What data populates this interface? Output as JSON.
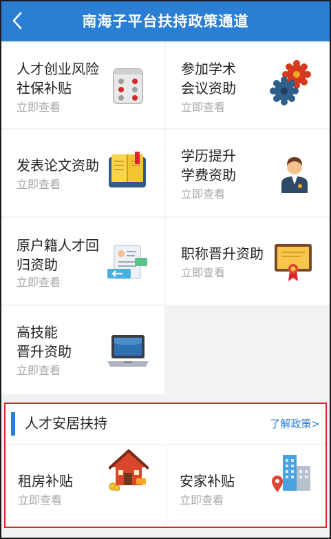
{
  "header": {
    "title": "南海子平台扶持政策通道"
  },
  "cards": [
    {
      "label": "人才创业风险\n社保补贴",
      "sub": "立即查看",
      "icon": "dice-icon"
    },
    {
      "label": "参加学术\n会议资助",
      "sub": "立即查看",
      "icon": "gears-icon"
    },
    {
      "label": "发表论文资助",
      "sub": "立即查看",
      "icon": "book-icon"
    },
    {
      "label": "学历提升\n学费资助",
      "sub": "立即查看",
      "icon": "graduate-icon"
    },
    {
      "label": "原户籍人才回\n归资助",
      "sub": "立即查看",
      "icon": "resume-icon"
    },
    {
      "label": "职称晋升资助",
      "sub": "立即查看",
      "icon": "certificate-icon"
    },
    {
      "label": "高技能\n晋升资助",
      "sub": "立即查看",
      "icon": "laptop-icon"
    }
  ],
  "housing": {
    "title": "人才安居扶持",
    "link": "了解政策>",
    "items": [
      {
        "label": "租房补贴",
        "sub": "立即查看",
        "icon": "house-icon"
      },
      {
        "label": "安家补贴",
        "sub": "立即查看",
        "icon": "buildings-icon"
      }
    ]
  },
  "colors": {
    "header": "#2a7fd4",
    "accent": "#2a7fd4",
    "highlight_border": "#d9262c"
  }
}
